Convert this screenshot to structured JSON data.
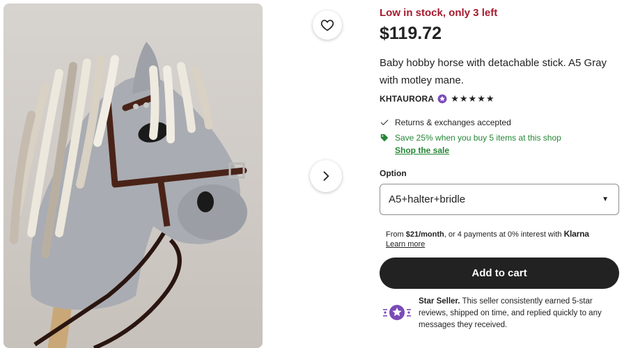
{
  "product": {
    "image_alt": "Gray hobby horse with white and tan mane and brown halter",
    "stock_notice": "Low in stock, only 3 left",
    "price": "$119.72",
    "title": "Baby hobby horse with detachable stick. A5 Gray with motley mane."
  },
  "seller": {
    "name": "KHTAURORA",
    "badge_icon": "star-seller-badge-icon",
    "rating_stars": 5,
    "stars_display": "★★★★★"
  },
  "perks": {
    "returns": "Returns & exchanges accepted",
    "sale": "Save 25% when you buy 5 items at this shop",
    "sale_link": "Shop the sale"
  },
  "option": {
    "label": "Option",
    "selected": "A5+halter+bridle"
  },
  "klarna": {
    "prefix": "From ",
    "amount": "$21/month",
    "suffix": ", or 4 payments at 0% interest with ",
    "brand": "Klarna",
    "learn_more": "Learn more"
  },
  "cart": {
    "label": "Add to cart"
  },
  "star_seller": {
    "title": "Star Seller.",
    "description": " This seller consistently earned 5-star reviews, shipped on time, and replied quickly to any messages they received."
  },
  "colors": {
    "stock_red": "#a61a2e",
    "sale_green": "#258635",
    "button_dark": "#222222",
    "star_seller_purple": "#7b4bb7"
  },
  "icons": {
    "favorite": "heart-icon",
    "next": "chevron-right-icon",
    "check": "check-icon",
    "tag": "tag-icon",
    "dropdown": "caret-down-icon"
  }
}
